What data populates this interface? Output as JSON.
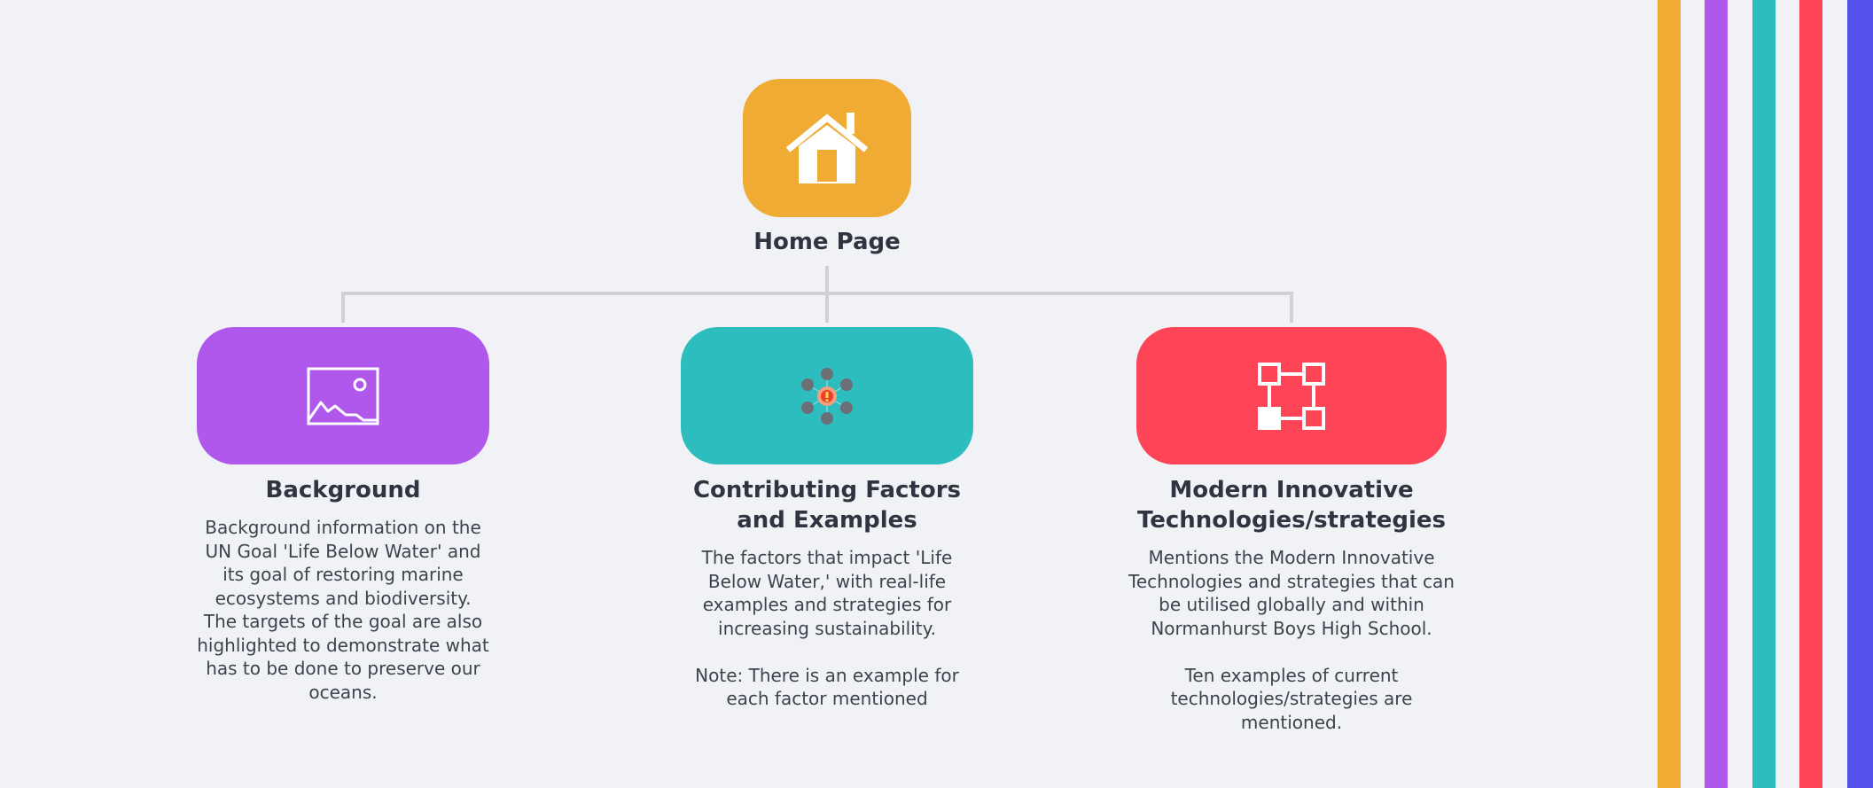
{
  "palette": {
    "orange": "#efab33",
    "purple": "#b057ec",
    "teal": "#2dbdbf",
    "red": "#fe4558",
    "blue": "#5454ec"
  },
  "root": {
    "label": "Home Page",
    "icon": "house-icon",
    "color": "#efab33"
  },
  "children": [
    {
      "title": "Background",
      "icon": "image-icon",
      "color": "#b057ec",
      "description": "Background information on the UN Goal 'Life Below Water' and its goal of restoring marine ecosystems and biodiversity. The targets of the goal are also highlighted to demonstrate what has to be done to preserve our oceans."
    },
    {
      "title": "Contributing Factors and Examples",
      "icon": "factors-network-icon",
      "color": "#2dbdbf",
      "description": "The factors that impact 'Life Below Water,' with real-life examples and strategies for increasing sustainability.\n\nNote: There is an example for each factor mentioned"
    },
    {
      "title": "Modern Innovative Technologies/strategies",
      "icon": "nodes-diagram-icon",
      "color": "#fe4558",
      "description": "Mentions the Modern Innovative Technologies and strategies that can be utilised globally and within Normanhurst Boys High School.\n\nTen examples of current technologies/strategies are mentioned."
    }
  ]
}
